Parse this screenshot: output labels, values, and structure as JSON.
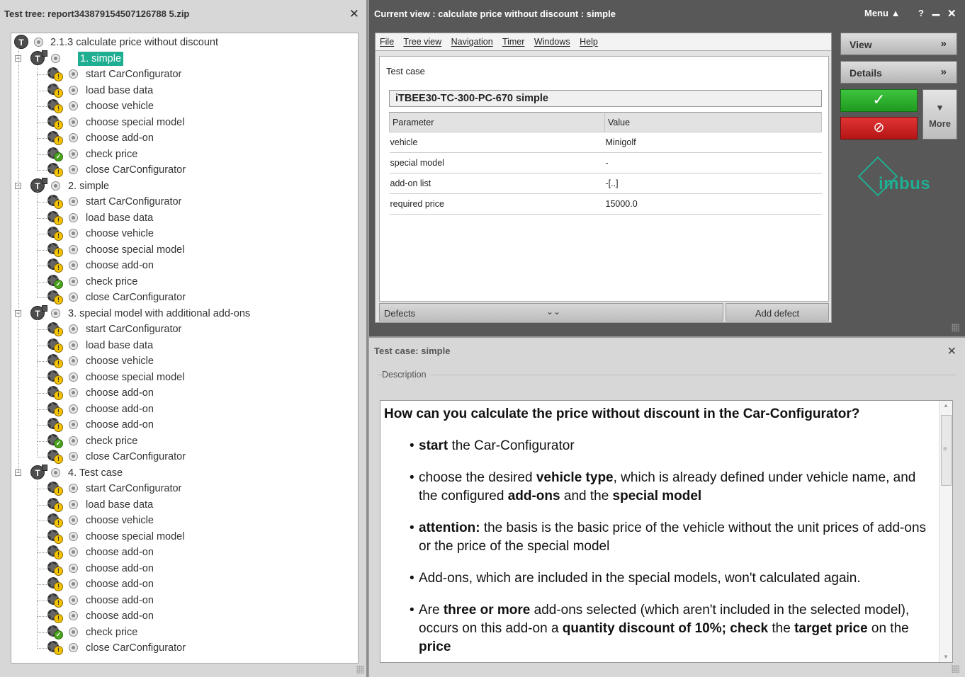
{
  "left_panel": {
    "title": "Test tree: report343879154507126788 5.zip",
    "close": "✕",
    "tree": {
      "root": "2.1.3 calculate price without discount",
      "cases": [
        {
          "label": "1.  simple",
          "selected": true,
          "steps": [
            {
              "label": "start CarConfigurator",
              "status": "warn"
            },
            {
              "label": "load base data",
              "status": "warn"
            },
            {
              "label": "choose vehicle",
              "status": "warn"
            },
            {
              "label": "choose special model",
              "status": "warn"
            },
            {
              "label": "choose add-on",
              "status": "warn"
            },
            {
              "label": "check price",
              "status": "ok"
            },
            {
              "label": "close CarConfigurator",
              "status": "warn"
            }
          ]
        },
        {
          "label": "2.  simple",
          "selected": false,
          "steps": [
            {
              "label": "start CarConfigurator",
              "status": "warn"
            },
            {
              "label": "load base data",
              "status": "warn"
            },
            {
              "label": "choose vehicle",
              "status": "warn"
            },
            {
              "label": "choose special model",
              "status": "warn"
            },
            {
              "label": "choose add-on",
              "status": "warn"
            },
            {
              "label": "check price",
              "status": "ok"
            },
            {
              "label": "close CarConfigurator",
              "status": "warn"
            }
          ]
        },
        {
          "label": "3.  special model with additional add-ons",
          "selected": false,
          "steps": [
            {
              "label": "start CarConfigurator",
              "status": "warn"
            },
            {
              "label": "load base data",
              "status": "warn"
            },
            {
              "label": "choose vehicle",
              "status": "warn"
            },
            {
              "label": "choose special model",
              "status": "warn"
            },
            {
              "label": "choose add-on",
              "status": "warn"
            },
            {
              "label": "choose add-on",
              "status": "warn"
            },
            {
              "label": "choose add-on",
              "status": "warn"
            },
            {
              "label": "check price",
              "status": "ok"
            },
            {
              "label": "close CarConfigurator",
              "status": "warn"
            }
          ]
        },
        {
          "label": "4. Test case",
          "selected": false,
          "steps": [
            {
              "label": "start CarConfigurator",
              "status": "warn"
            },
            {
              "label": "load base data",
              "status": "warn"
            },
            {
              "label": "choose vehicle",
              "status": "warn"
            },
            {
              "label": "choose special model",
              "status": "warn"
            },
            {
              "label": "choose add-on",
              "status": "warn"
            },
            {
              "label": "choose add-on",
              "status": "warn"
            },
            {
              "label": "choose add-on",
              "status": "warn"
            },
            {
              "label": "choose add-on",
              "status": "warn"
            },
            {
              "label": "choose add-on",
              "status": "warn"
            },
            {
              "label": "check price",
              "status": "ok"
            },
            {
              "label": "close CarConfigurator",
              "status": "warn"
            }
          ]
        }
      ]
    }
  },
  "current_view": {
    "title": "Current view : calculate price without discount :  simple",
    "menu_label": "Menu",
    "menu_arrow": "▲",
    "help": "?",
    "minimize": "▁",
    "close": "✕",
    "menubar": {
      "file": "File",
      "tree_view": "Tree view",
      "navigation": "Navigation",
      "timer": "Timer",
      "windows": "Windows",
      "help": "Help"
    },
    "test_case_header": "Test case",
    "test_case_name": "iTBEE30-TC-300-PC-670  simple",
    "table": {
      "headers": [
        "Parameter",
        "Value"
      ],
      "rows": [
        [
          "vehicle",
          "Minigolf"
        ],
        [
          "special model",
          "-"
        ],
        [
          "add-on list",
          "-[..]"
        ],
        [
          "required price",
          "15000.0"
        ]
      ]
    },
    "defects_label": "Defects",
    "defects_chevron": "⌄⌄",
    "add_defect": "Add defect",
    "view_button": "View",
    "details_button": "Details",
    "button_chevron": "»",
    "pass_icon": "✓",
    "fail_icon": "⊘",
    "more_arrow": "▾",
    "more_button": "More",
    "logo_text": "imbus",
    "colors": {
      "accent": "#1fae91",
      "pass": "#2bb52b",
      "fail": "#c91f1f"
    }
  },
  "test_case_panel": {
    "title": "Test case:  simple",
    "close": "✕",
    "description_label": "Description",
    "description": {
      "question": "How can you calculate the price without discount in the Car-Configurator?",
      "items": [
        [
          {
            "t": "start",
            "b": true
          },
          {
            "t": " the Car-Configurator",
            "b": false
          }
        ],
        [
          {
            "t": "choose the desired ",
            "b": false
          },
          {
            "t": "vehicle type",
            "b": true
          },
          {
            "t": ", which is already defined under vehicle name, and the configured ",
            "b": false
          },
          {
            "t": "add-ons",
            "b": true
          },
          {
            "t": " and the ",
            "b": false
          },
          {
            "t": "special model",
            "b": true
          }
        ],
        [
          {
            "t": "attention:",
            "b": true
          },
          {
            "t": " the basis is the basic price of the vehicle without the unit prices of add-ons or the price of the special model",
            "b": false
          }
        ],
        [
          {
            "t": "Add-ons, which are included in the special models, won't calculated again.",
            "b": false
          }
        ],
        [
          {
            "t": "Are ",
            "b": false
          },
          {
            "t": "three or more",
            "b": true
          },
          {
            "t": " add-ons selected (which aren't included in the selected model), occurs on this add-on a ",
            "b": false
          },
          {
            "t": "quantity discount of 10%; check",
            "b": true
          },
          {
            "t": " the ",
            "b": false
          },
          {
            "t": "target price",
            "b": true
          },
          {
            "t": " on the ",
            "b": false
          },
          {
            "t": "price",
            "b": true
          }
        ]
      ]
    },
    "scroll_up": "▲",
    "scroll_down": "▼",
    "scroll_grip": "≡"
  }
}
